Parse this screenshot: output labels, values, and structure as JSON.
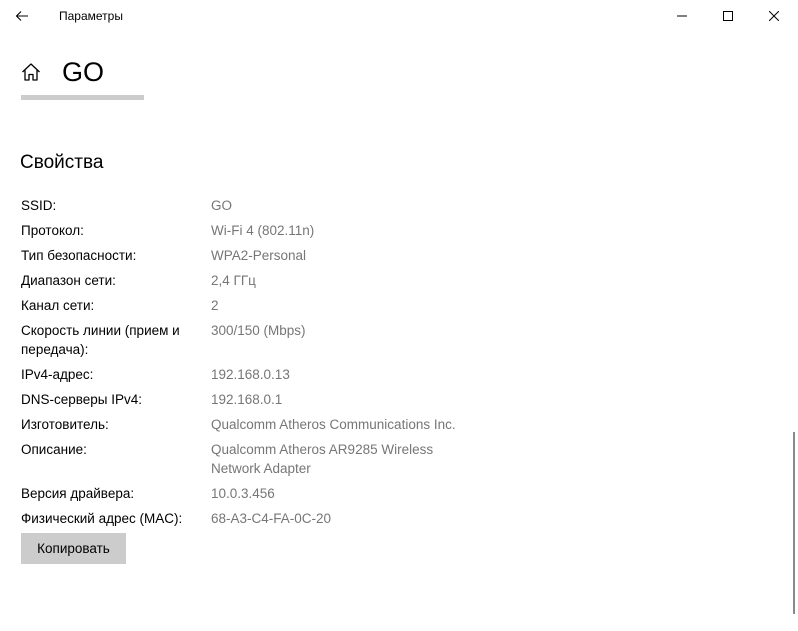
{
  "titlebar": {
    "app_title": "Параметры"
  },
  "header": {
    "title": "GO"
  },
  "section": {
    "heading": "Свойства"
  },
  "properties": [
    {
      "label": "SSID:",
      "value": "GO"
    },
    {
      "label": "Протокол:",
      "value": "Wi-Fi 4 (802.11n)"
    },
    {
      "label": "Тип безопасности:",
      "value": "WPA2-Personal"
    },
    {
      "label": "Диапазон сети:",
      "value": "2,4 ГГц"
    },
    {
      "label": "Канал сети:",
      "value": "2"
    },
    {
      "label": "Скорость линии (прием и передача):",
      "value": "300/150 (Mbps)"
    },
    {
      "label": "IPv4-адрес:",
      "value": "192.168.0.13"
    },
    {
      "label": "DNS-серверы IPv4:",
      "value": "192.168.0.1"
    },
    {
      "label": "Изготовитель:",
      "value": "Qualcomm Atheros Communications Inc."
    },
    {
      "label": "Описание:",
      "value": "Qualcomm Atheros AR9285 Wireless Network Adapter"
    },
    {
      "label": "Версия драйвера:",
      "value": "10.0.3.456"
    },
    {
      "label": "Физический адрес (MAC):",
      "value": "68-A3-C4-FA-0C-20"
    }
  ],
  "actions": {
    "copy_label": "Копировать"
  },
  "icons": {
    "back": "back-arrow-icon",
    "home": "home-icon",
    "minimize": "minimize-icon",
    "maximize": "maximize-icon",
    "close": "close-icon"
  },
  "colors": {
    "value_text": "#767676",
    "button_bg": "#cccccc",
    "underline": "#cccccc"
  }
}
